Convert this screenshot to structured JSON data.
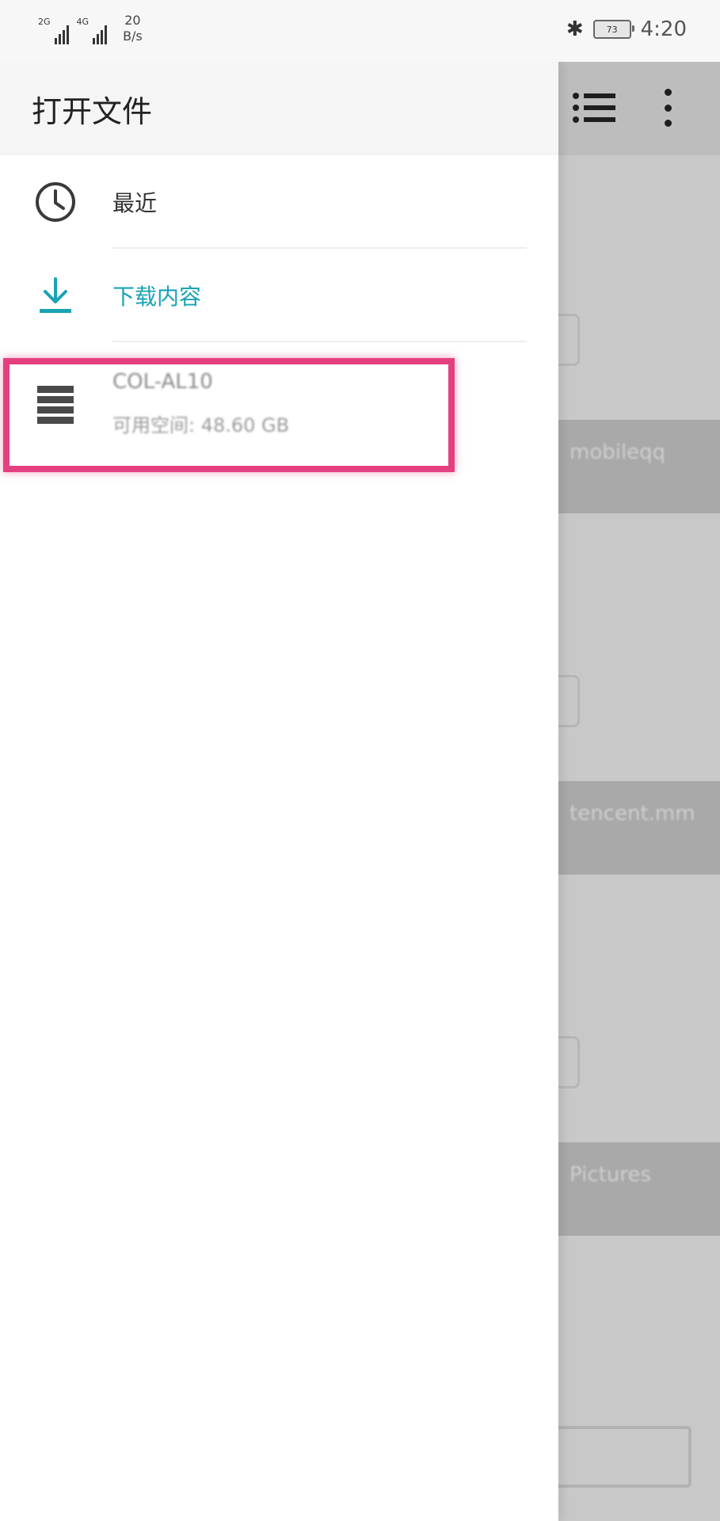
{
  "status_bar": {
    "signal1_tech": "2G",
    "signal2_tech": "4G",
    "speed_value": "20",
    "speed_unit": "B/s",
    "battery_level": "73",
    "time": "4:20"
  },
  "drawer": {
    "title": "打开文件",
    "items": [
      {
        "label": "最近",
        "icon": "clock-icon"
      },
      {
        "label": "下载内容",
        "icon": "download-icon",
        "active_color": "#19a3b5"
      }
    ],
    "storage": {
      "title": "COL-AL10",
      "subtitle": "可用空间: 48.60 GB",
      "icon": "storage-icon"
    }
  },
  "background": {
    "cards": [
      "mobileqq",
      "tencent.mm",
      "Pictures"
    ],
    "icons": [
      "list-view-icon",
      "more-vert-icon"
    ]
  },
  "colors": {
    "accent": "#19a3b5",
    "highlight": "#e4407f"
  }
}
